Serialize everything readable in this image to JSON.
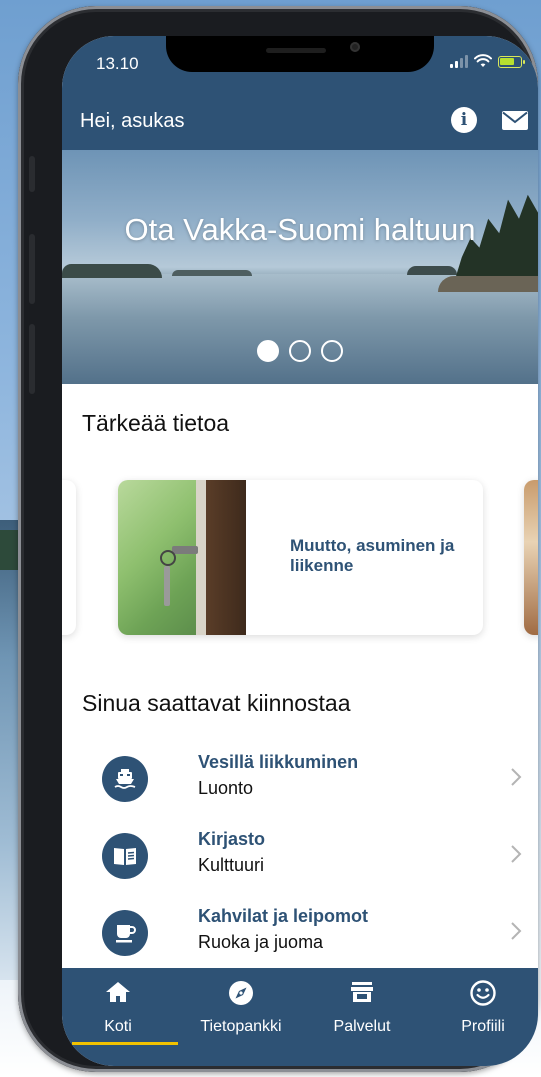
{
  "status_bar": {
    "time": "13.10"
  },
  "header": {
    "greeting": "Hei, asukas",
    "info_icon": "info-icon",
    "mail_icon": "mail-icon"
  },
  "hero": {
    "title": "Ota Vakka-Suomi haltuun",
    "slides": 3,
    "active_slide": 1
  },
  "important": {
    "title": "Tärkeää tietoa",
    "cards": [
      {
        "label": "Muutto, asuminen ja liikenne",
        "image": "door-key-photo"
      }
    ]
  },
  "interests": {
    "title": "Sinua saattavat kiinnostaa",
    "items": [
      {
        "title": "Vesillä liikkuminen",
        "subtitle": "Luonto",
        "icon": "ferry-icon"
      },
      {
        "title": "Kirjasto",
        "subtitle": "Kulttuuri",
        "icon": "book-icon"
      },
      {
        "title": "Kahvilat ja leipomot",
        "subtitle": "Ruoka ja juoma",
        "icon": "coffee-cup-icon"
      }
    ]
  },
  "tabs": [
    {
      "label": "Koti",
      "icon": "home-icon",
      "active": true
    },
    {
      "label": "Tietopankki",
      "icon": "compass-icon",
      "active": false
    },
    {
      "label": "Palvelut",
      "icon": "store-icon",
      "active": false
    },
    {
      "label": "Profiili",
      "icon": "smiley-icon",
      "active": false
    }
  ],
  "colors": {
    "primary": "#2e5275",
    "accent": "#f2c200",
    "background": "#ffffff"
  }
}
